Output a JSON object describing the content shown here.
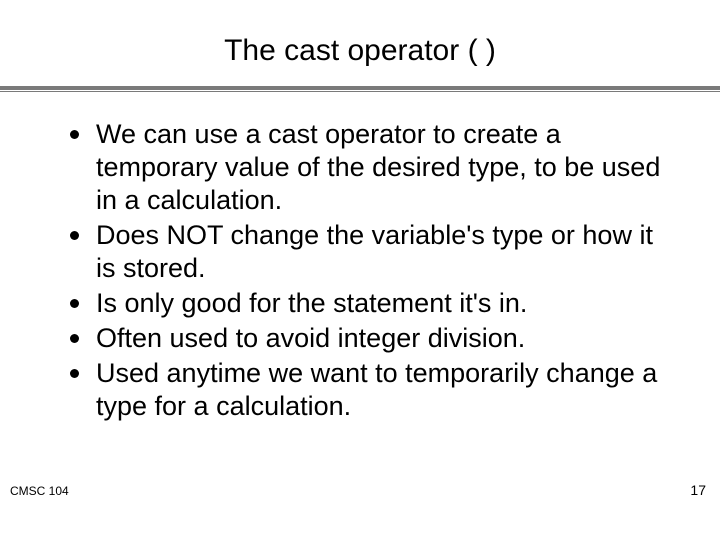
{
  "slide": {
    "title": "The cast operator  ( )",
    "bullets": [
      "We can use a cast operator to create a temporary value of the desired type, to be used in a calculation.",
      "Does NOT change the variable's type or how it is stored.",
      "Is only good for the statement it's in.",
      "Often used to avoid integer division.",
      "Used anytime we want to temporarily change a type for a calculation."
    ],
    "footer_left": "CMSC 104",
    "footer_right": "17"
  }
}
